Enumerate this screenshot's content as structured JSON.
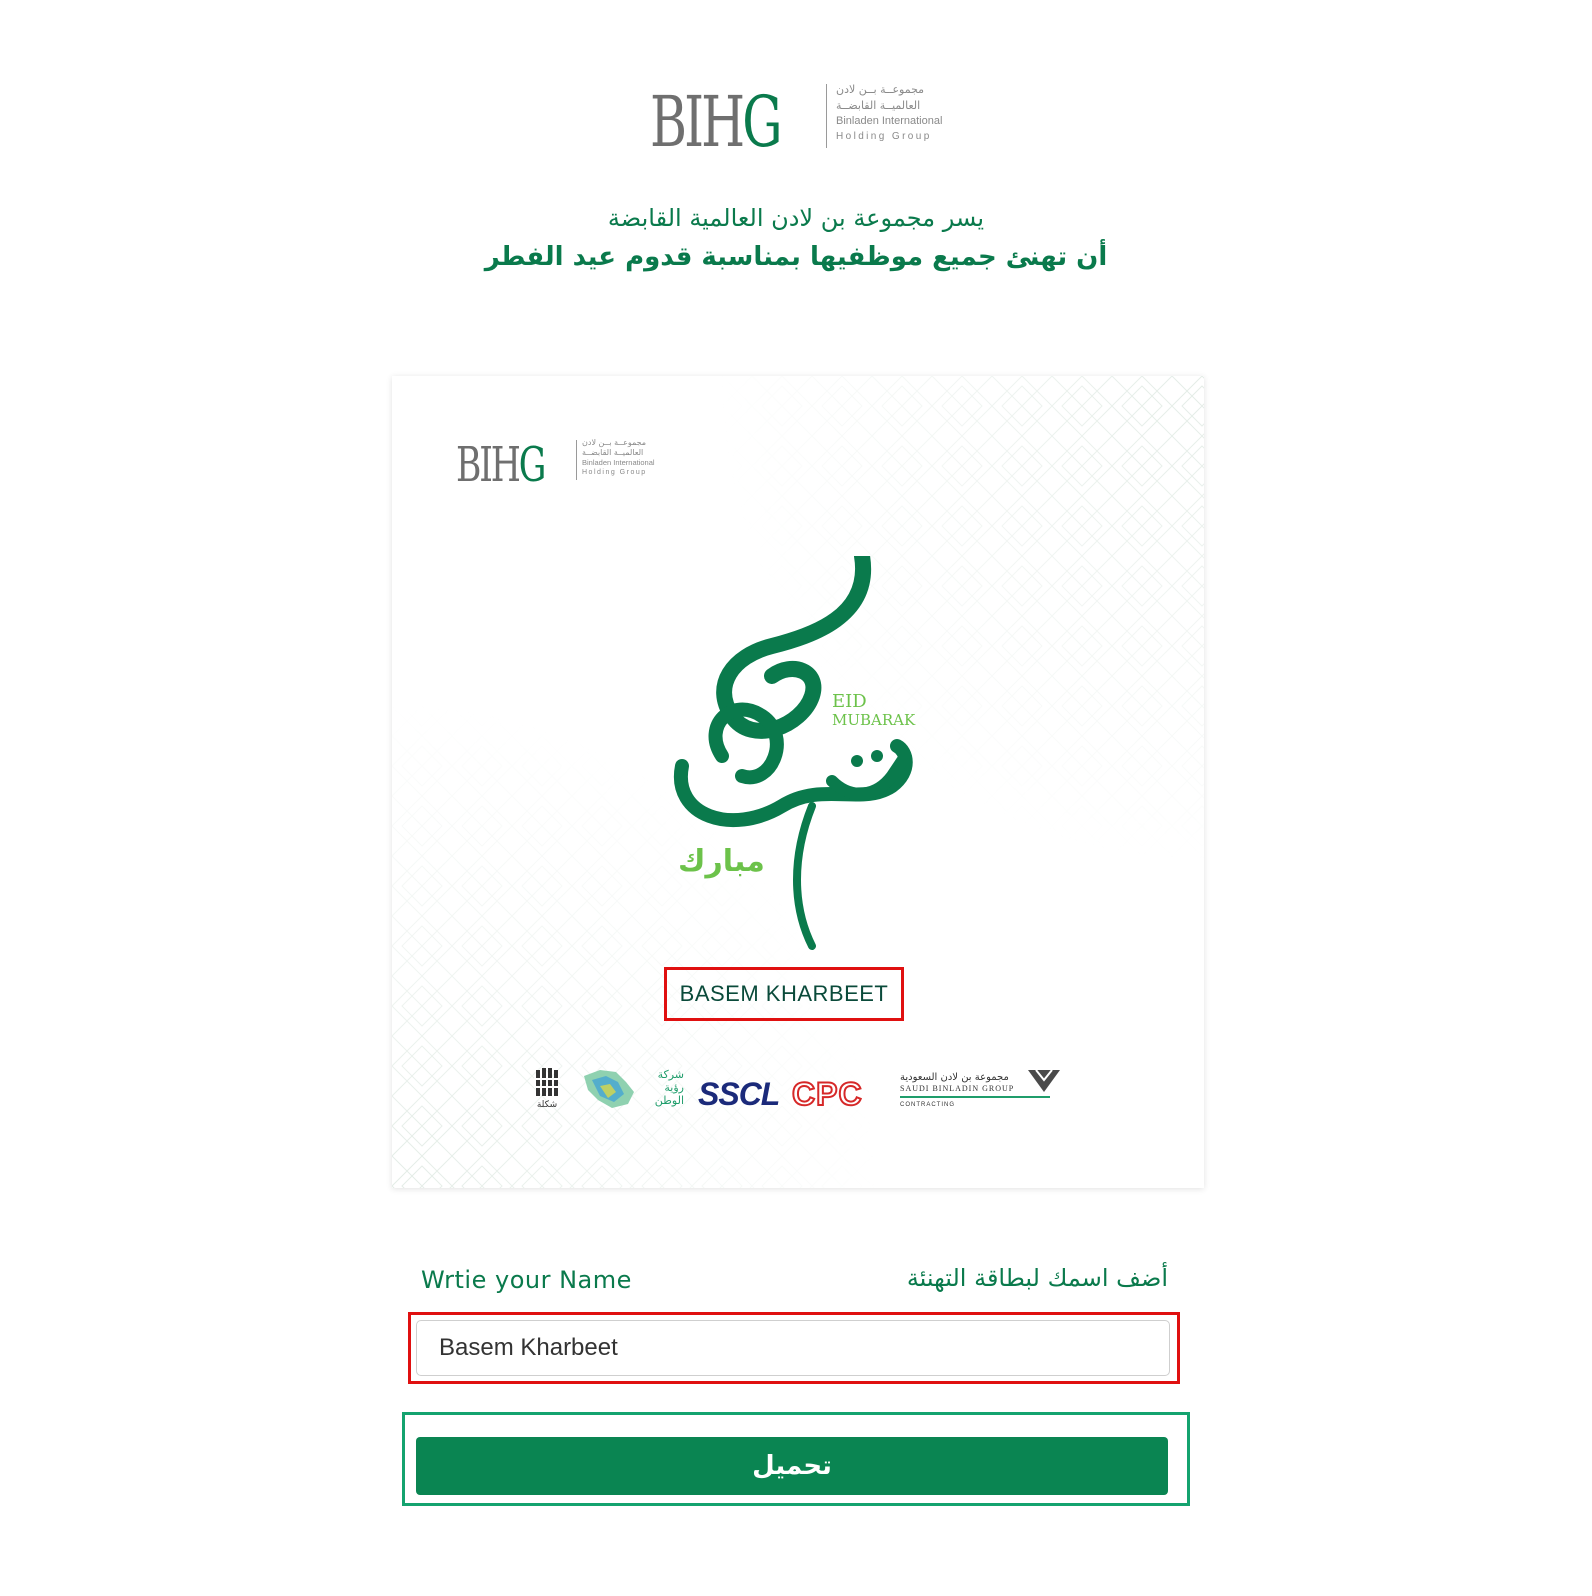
{
  "logo": {
    "letters_main": "BIH",
    "letters_accent": "G",
    "ar_line1": "مجموعــة بــن لادن",
    "ar_line2": "العالميــة القابضــة",
    "en_line1": "Binladen International",
    "en_line2": "Holding Group"
  },
  "greeting": {
    "line1": "يسر مجموعة بن لادن العالمية القابضة",
    "line2": "أن تهنئ جميع موظفيها بمناسبة قدوم عيد الفطر"
  },
  "card": {
    "eid_en_line1": "EID",
    "eid_en_line2": "MUBARAK",
    "mubarak_ar": "مبارك",
    "recipient_name": "BASEM KHARBEET",
    "partners": {
      "sp_label": "شكلة",
      "vision_label": "شركة رؤية الوطن",
      "sscl": "SSCL",
      "cpc": "CPC",
      "sbg_ar": "مجموعة بن لادن السعودية",
      "sbg_en": "SAUDI BINLADIN GROUP",
      "sbg_sub": "CONTRACTING"
    },
    "colors": {
      "primary": "#0a7a4c",
      "light_green": "#6cc24a",
      "highlight": "#e01010"
    }
  },
  "form": {
    "label_en": "Wrtie your Name",
    "label_ar": "أضف اسمك لبطاقة التهنئة",
    "name_value": "Basem Kharbeet",
    "download_label": "تحميل"
  },
  "colors": {
    "button": "#0a8552",
    "button_frame": "#14a36f",
    "input_frame": "#e01010"
  }
}
